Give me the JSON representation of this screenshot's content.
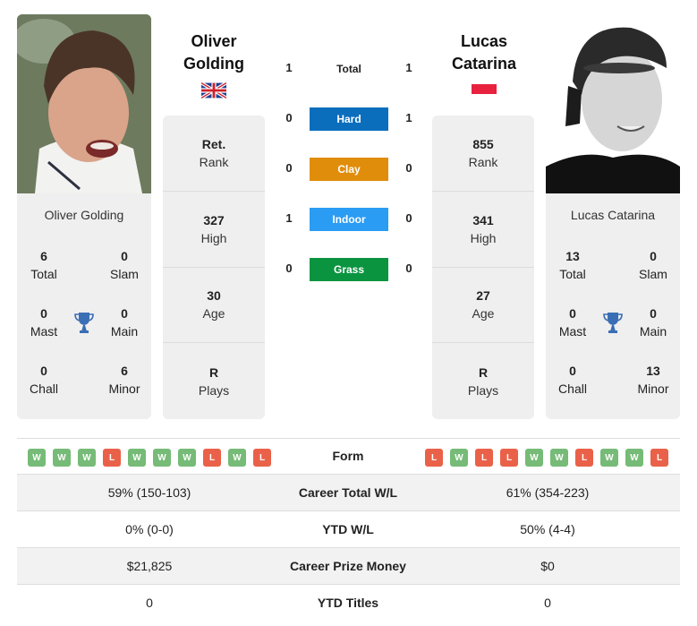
{
  "player1": {
    "name_line1": "Oliver",
    "name_line2": "Golding",
    "full_name": "Oliver Golding",
    "flag": "united-kingdom-flag",
    "stats": [
      {
        "value": "Ret.",
        "label": "Rank"
      },
      {
        "value": "327",
        "label": "High"
      },
      {
        "value": "30",
        "label": "Age"
      },
      {
        "value": "R",
        "label": "Plays"
      }
    ],
    "titles": {
      "total": {
        "value": "6",
        "label": "Total"
      },
      "slam": {
        "value": "0",
        "label": "Slam"
      },
      "mast": {
        "value": "0",
        "label": "Mast"
      },
      "main": {
        "value": "0",
        "label": "Main"
      },
      "chall": {
        "value": "0",
        "label": "Chall"
      },
      "minor": {
        "value": "6",
        "label": "Minor"
      }
    },
    "form": [
      "W",
      "W",
      "W",
      "L",
      "W",
      "W",
      "W",
      "L",
      "W",
      "L"
    ]
  },
  "player2": {
    "name_line1": "Lucas",
    "name_line2": "Catarina",
    "full_name": "Lucas Catarina",
    "flag": "monaco-flag",
    "stats": [
      {
        "value": "855",
        "label": "Rank"
      },
      {
        "value": "341",
        "label": "High"
      },
      {
        "value": "27",
        "label": "Age"
      },
      {
        "value": "R",
        "label": "Plays"
      }
    ],
    "titles": {
      "total": {
        "value": "13",
        "label": "Total"
      },
      "slam": {
        "value": "0",
        "label": "Slam"
      },
      "mast": {
        "value": "0",
        "label": "Mast"
      },
      "main": {
        "value": "0",
        "label": "Main"
      },
      "chall": {
        "value": "0",
        "label": "Chall"
      },
      "minor": {
        "value": "13",
        "label": "Minor"
      }
    },
    "form": [
      "L",
      "W",
      "L",
      "L",
      "W",
      "W",
      "L",
      "W",
      "W",
      "L"
    ]
  },
  "h2h": [
    {
      "label": "Total",
      "p1": "1",
      "p2": "1",
      "color": null
    },
    {
      "label": "Hard",
      "p1": "0",
      "p2": "1",
      "color": "#0a6ebd"
    },
    {
      "label": "Clay",
      "p1": "0",
      "p2": "0",
      "color": "#e08d0b"
    },
    {
      "label": "Indoor",
      "p1": "1",
      "p2": "0",
      "color": "#2b9cf3"
    },
    {
      "label": "Grass",
      "p1": "0",
      "p2": "0",
      "color": "#0a9440"
    }
  ],
  "form_label": "Form",
  "comparison": [
    {
      "label": "Career Total W/L",
      "p1": "59% (150-103)",
      "p2": "61% (354-223)"
    },
    {
      "label": "YTD W/L",
      "p1": "0% (0-0)",
      "p2": "50% (4-4)"
    },
    {
      "label": "Career Prize Money",
      "p1": "$21,825",
      "p2": "$0"
    },
    {
      "label": "YTD Titles",
      "p1": "0",
      "p2": "0"
    }
  ],
  "colors": {
    "win": "#76bb77",
    "loss": "#ea6149",
    "trophy": "#3a6fb5"
  }
}
